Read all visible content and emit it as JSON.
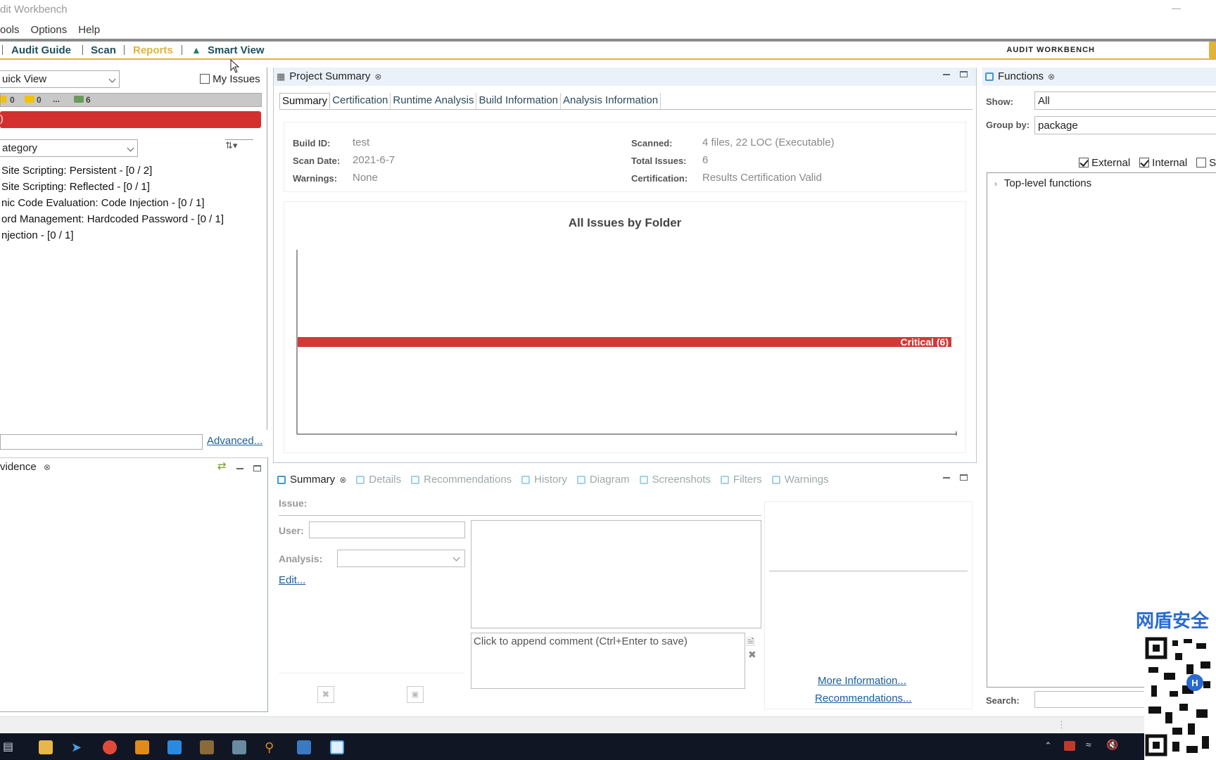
{
  "window": {
    "title": "dit Workbench"
  },
  "menu": [
    "ools",
    "Options",
    "Help"
  ],
  "toolbar": {
    "items": [
      "Audit Guide",
      "Scan",
      "Reports",
      "Smart View"
    ],
    "brand": "AUDIT WORKBENCH",
    "colors": {
      "brand_accent": "#e2b33a",
      "reports": "#e2b33a",
      "nav": "#1d4f5c"
    }
  },
  "left": {
    "view_select": "uick View",
    "my_issues_label": "My Issues",
    "counts": [
      "0",
      "0",
      "...",
      "6"
    ],
    "red_bar_text": ")",
    "group_select": "ategory",
    "categories": [
      "Site Scripting: Persistent - [0 / 2]",
      "Site Scripting: Reflected - [0 / 1]",
      "nic Code Evaluation: Code Injection - [0 / 1]",
      "ord Management: Hardcoded Password - [0 / 1]",
      "njection - [0 / 1]"
    ],
    "advanced_link": "Advanced...",
    "evidence_title": "vidence"
  },
  "project_summary": {
    "tab_title": "Project Summary",
    "subtabs": [
      "Summary",
      "Certification",
      "Runtime Analysis",
      "Build Information",
      "Analysis Information"
    ],
    "info": {
      "build_id_label": "Build ID:",
      "build_id": "test",
      "scan_date_label": "Scan Date:",
      "scan_date": "2021-6-7",
      "warnings_label": "Warnings:",
      "warnings": "None",
      "scanned_label": "Scanned:",
      "scanned": "4 files, 22 LOC (Executable)",
      "total_issues_label": "Total Issues:",
      "total_issues": "6",
      "certification_label": "Certification:",
      "certification": "Results Certification Valid"
    }
  },
  "chart_data": {
    "type": "bar",
    "title": "All Issues by Folder",
    "orientation": "horizontal",
    "categories": [
      "Critical"
    ],
    "values": [
      6
    ],
    "data_labels": [
      "Critical (6)"
    ],
    "colors": [
      "#d03a35"
    ]
  },
  "issue_summary": {
    "tabs": [
      "Summary",
      "Details",
      "Recommendations",
      "History",
      "Diagram",
      "Screenshots",
      "Filters",
      "Warnings"
    ],
    "issue_label": "Issue:",
    "user_label": "User:",
    "analysis_label": "Analysis:",
    "edit_link": "Edit...",
    "comment_placeholder": "Click to append comment (Ctrl+Enter to save)",
    "more_info_link": "More Information...",
    "recommendations_link": "Recommendations..."
  },
  "functions": {
    "title": "Functions",
    "show_label": "Show:",
    "show_value": "All",
    "group_label": "Group by:",
    "group_value": "package",
    "filters": [
      {
        "label": "External",
        "checked": true
      },
      {
        "label": "Internal",
        "checked": true
      },
      {
        "label": "S",
        "checked": false
      }
    ],
    "tree_root": "Top-level functions",
    "search_label": "Search:"
  },
  "watermark_text": "网盾安全"
}
